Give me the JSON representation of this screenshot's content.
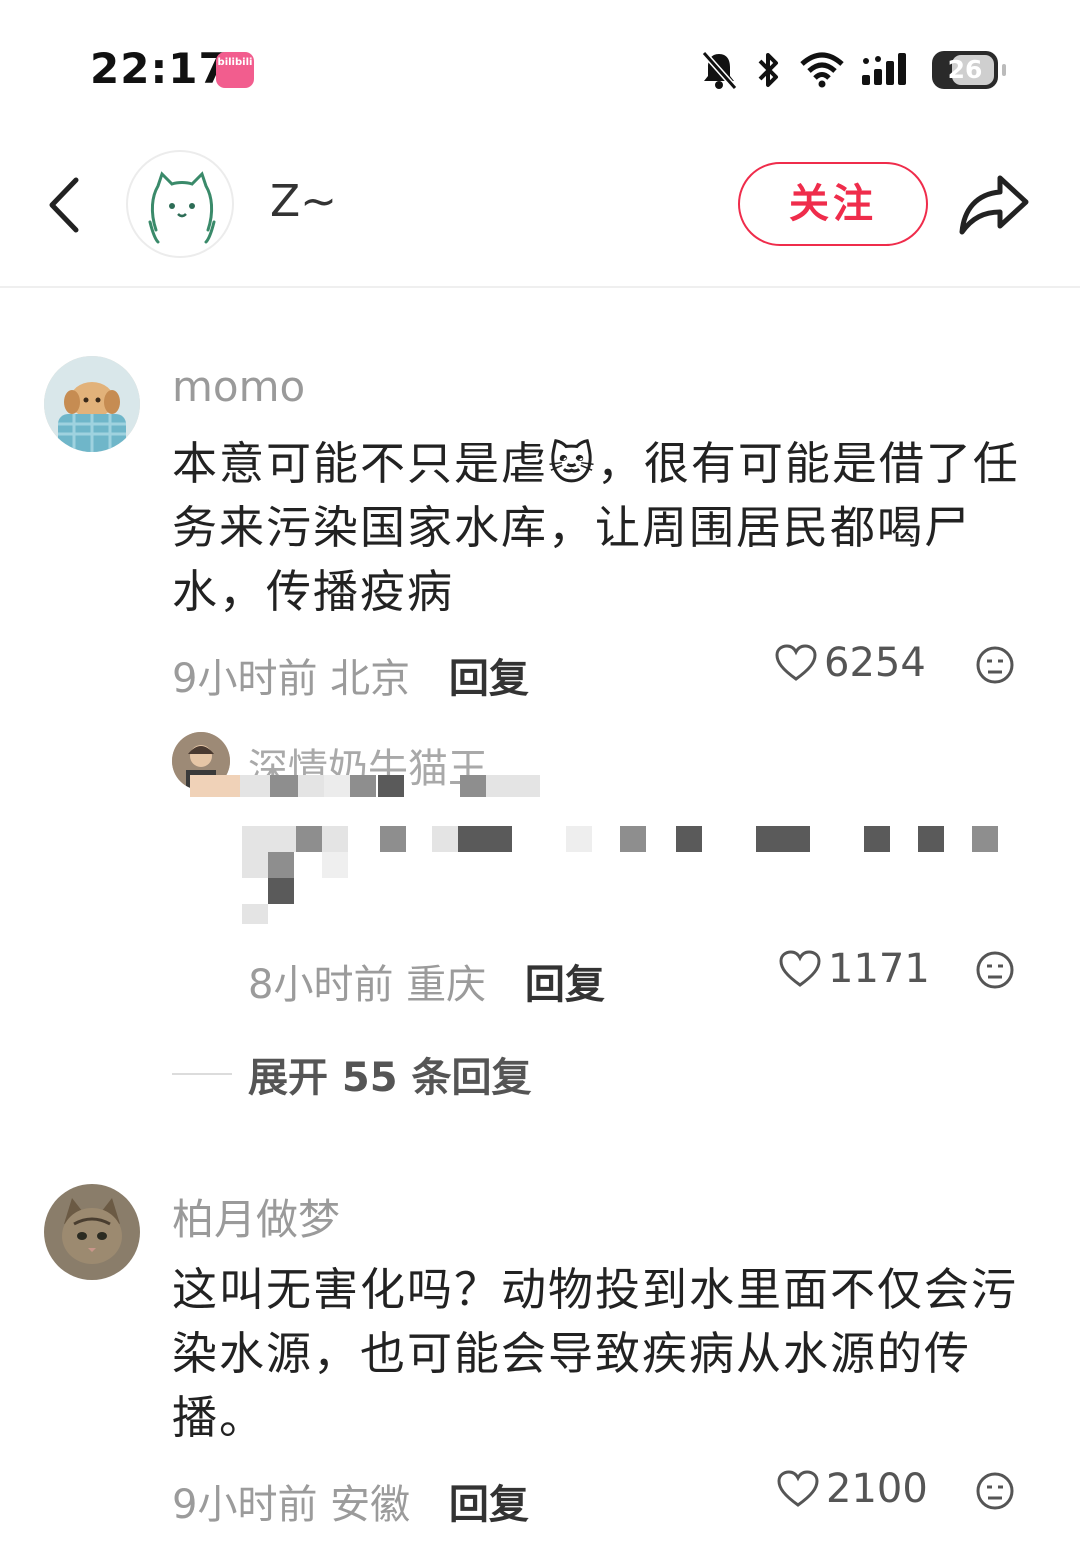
{
  "status_bar": {
    "time": "22:17",
    "app_badge_text": "bilibili",
    "battery_level": "26",
    "icons": [
      "bell-muted-icon",
      "bluetooth-icon",
      "wifi-icon",
      "signal-icon",
      "battery-icon"
    ]
  },
  "header": {
    "name": "Z~",
    "follow_label": "关注"
  },
  "comments": [
    {
      "username": "momo",
      "text": "本意可能不只是虐🐱，很有可能是借了任务来污染国家水库，让周围居民都喝尸水，传播疫病",
      "time": "9小时前",
      "location": "北京",
      "reply_label": "回复",
      "likes": "6254",
      "sub_reply": {
        "username": "深情奶牛猫王",
        "time": "8小时前",
        "location": "重庆",
        "reply_label": "回复",
        "likes": "1171"
      },
      "expand_label": "展开 55 条回复"
    },
    {
      "username": "柏月做梦",
      "text": "这叫无害化吗？动物投到水里面不仅会污染水源，也可能会导致疾病从水源的传播。",
      "time": "9小时前",
      "location": "安徽",
      "reply_label": "回复",
      "likes": "2100"
    }
  ],
  "colors": {
    "accent": "#ef2c4b",
    "muted_text": "#9b9b9b"
  }
}
